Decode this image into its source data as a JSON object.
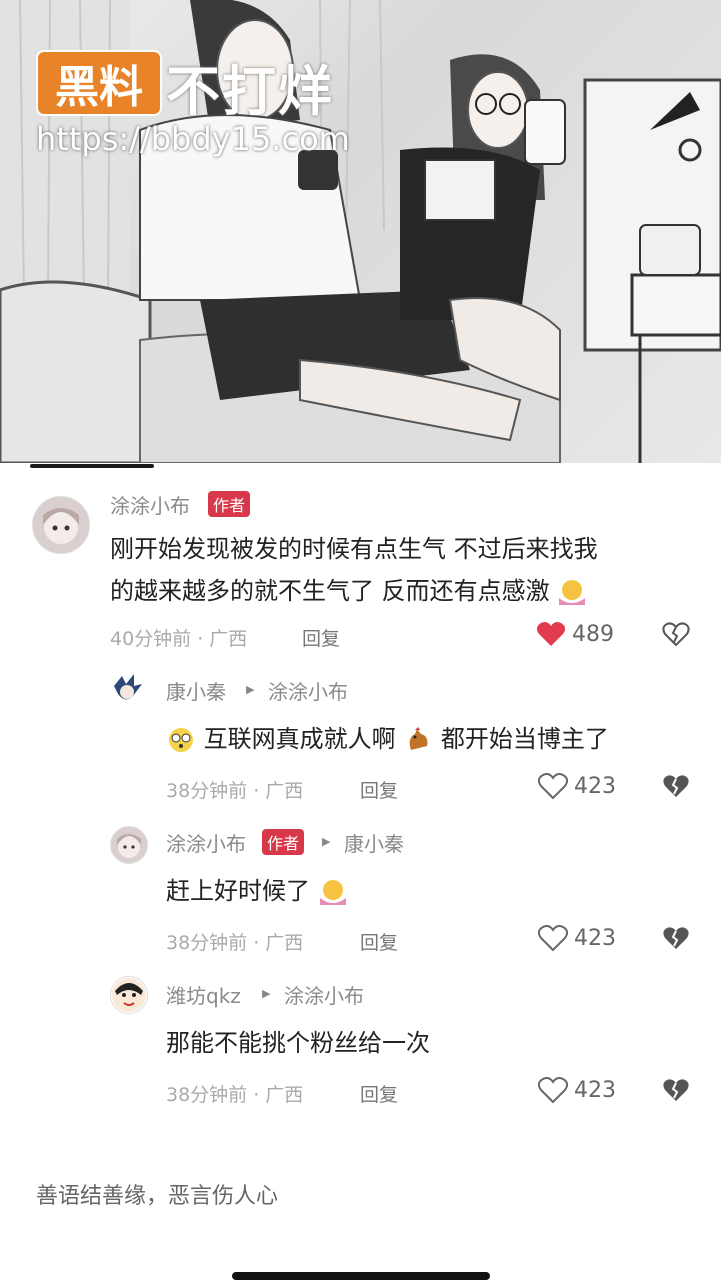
{
  "hero": {
    "watermark_box": "黑料",
    "watermark_text": "不打烊",
    "watermark_url": "https://bbdy15.com"
  },
  "comments": [
    {
      "author": "涂涂小布",
      "badge": "作者",
      "text_line1": "刚开始发现被发的时候有点生气 不过后来找我",
      "text_line2": "的越来越多的就不生气了 反而还有点感激",
      "time": "40分钟前 · 广西",
      "reply_label": "回复",
      "likes": "489",
      "liked": true
    },
    {
      "author": "康小秦",
      "reply_to": "涂涂小布",
      "text_part1": "互联网真成就人啊",
      "text_part2": "都开始当博主了",
      "time": "38分钟前 · 广西",
      "reply_label": "回复",
      "likes": "423"
    },
    {
      "author": "涂涂小布",
      "badge": "作者",
      "reply_to": "康小秦",
      "text": "赶上好时候了",
      "time": "38分钟前 · 广西",
      "reply_label": "回复",
      "likes": "423"
    },
    {
      "author": "潍坊qkz",
      "reply_to": "涂涂小布",
      "text": "那能不能挑个粉丝给一次",
      "time": "38分钟前 · 广西",
      "reply_label": "回复",
      "likes": "423"
    }
  ],
  "footer": {
    "slogan": "善语结善缘，恶言伤人心"
  },
  "colors": {
    "badge": "#d8394a",
    "liked_heart": "#e23b4e",
    "watermark_box": "#e8832a"
  },
  "icons": {
    "like": "heart-icon",
    "dislike": "broken-heart-icon",
    "reply_arrow": "triangle-right-icon"
  }
}
